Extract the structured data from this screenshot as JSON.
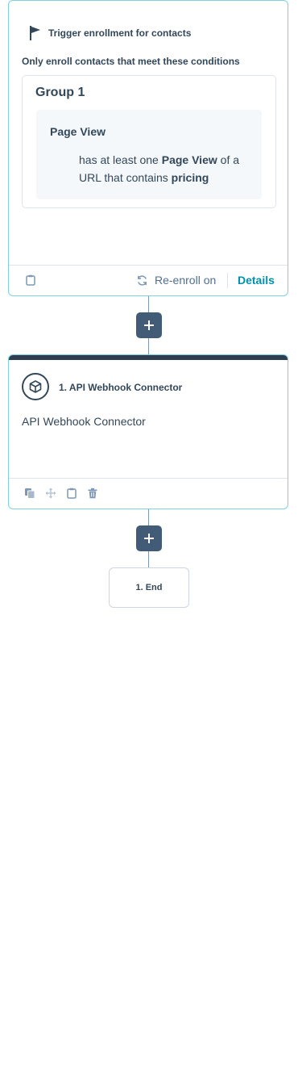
{
  "trigger": {
    "title": "Trigger enrollment for contacts",
    "conditions_label": "Only enroll contacts that meet these conditions",
    "group": {
      "title": "Group 1",
      "filter": {
        "title": "Page View",
        "desc_prefix": "has at least one ",
        "desc_bold1": "Page View",
        "desc_mid": " of a URL that contains ",
        "desc_bold2": "pricing"
      }
    },
    "footer": {
      "reenroll_label": "Re-enroll on",
      "details_label": "Details"
    }
  },
  "action": {
    "title": "1. API Webhook Connector",
    "description": "API Webhook Connector"
  },
  "end": {
    "label": "1. End"
  },
  "colors": {
    "card_border": "#7fd1de",
    "accent_link": "#0091ae",
    "plus_button": "#425b76",
    "action_topbar": "#2d3e50",
    "text": "#33475b"
  },
  "icons": [
    "flag-icon",
    "clipboard-icon",
    "refresh-icon",
    "box-icon",
    "copy-icon",
    "move-icon",
    "clipboard-icon",
    "trash-icon",
    "plus-icon"
  ]
}
